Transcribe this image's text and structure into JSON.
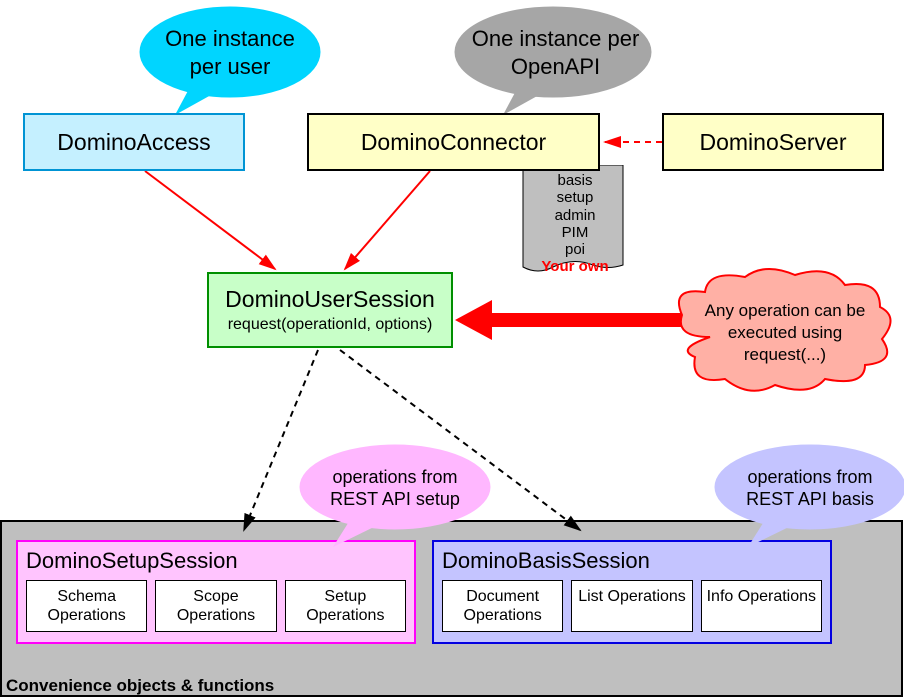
{
  "bubbles": {
    "perUser": "One instance per user",
    "perOpenAPI": "One instance per OpenAPI",
    "setupOps": "operations from REST API setup",
    "basisOps": "operations from REST API basis",
    "anyOp": "Any operation can be executed using request(...)"
  },
  "boxes": {
    "access": "DominoAccess",
    "connector": "DominoConnector",
    "server": "DominoServer",
    "userSessionTitle": "DominoUserSession",
    "userSessionSub": "request(operationId, options)"
  },
  "connectorList": {
    "items": [
      "basis",
      "setup",
      "admin",
      "PIM",
      "poi"
    ],
    "own": "Your own"
  },
  "setupSession": {
    "title": "DominoSetupSession",
    "ops": [
      "Schema Operations",
      "Scope Operations",
      "Setup Operations"
    ]
  },
  "basisSession": {
    "title": "DominoBasisSession",
    "ops": [
      "Document Operations",
      "List Operations",
      "Info Operations"
    ]
  },
  "footer": "Convenience objects & functions"
}
